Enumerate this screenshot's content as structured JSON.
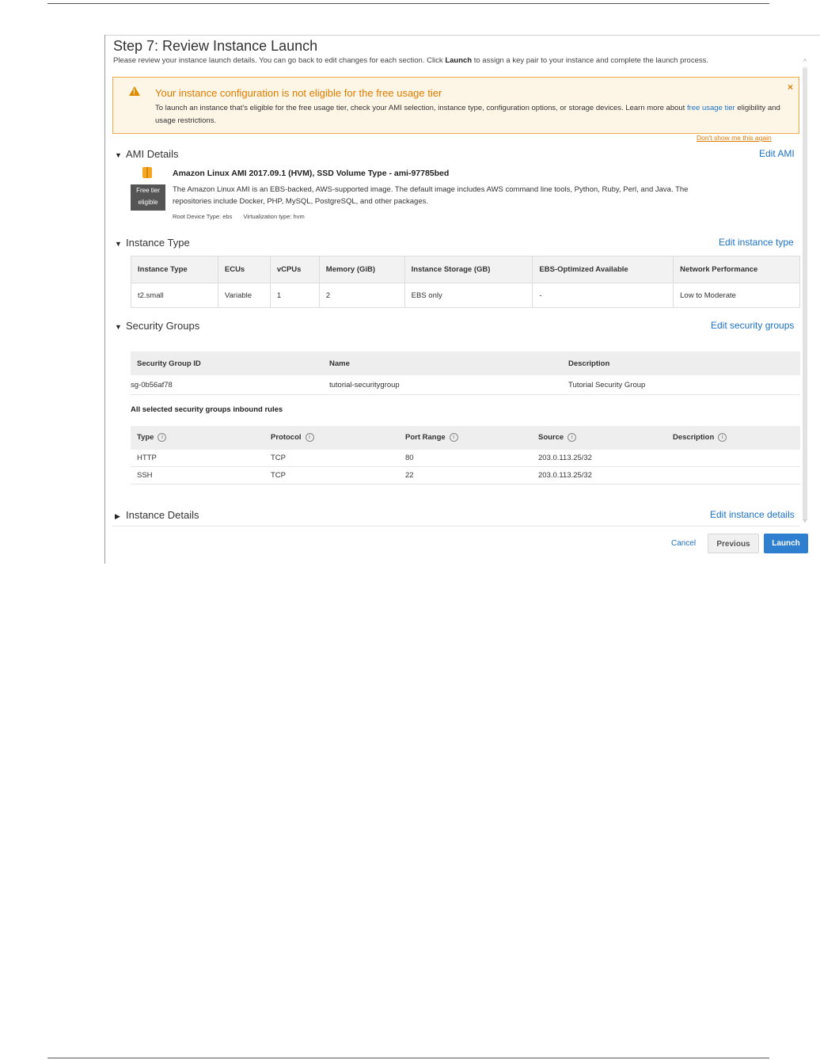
{
  "header": {
    "title": "Step 7: Review Instance Launch",
    "description_pre": "Please review your instance launch details. You can go back to edit changes for each section. Click ",
    "description_bold": "Launch",
    "description_post": " to assign a key pair to your instance and complete the launch process."
  },
  "warning": {
    "title": "Your instance configuration is not eligible for the free usage tier",
    "text_pre": "To launch an instance that's eligible for the free usage tier, check your AMI selection, instance type, configuration options, or storage devices. Learn more about ",
    "link_text": "free usage tier",
    "text_post": " eligibility and usage restrictions.",
    "close": "×",
    "dont_show": "Don't show me this again",
    "color": "#e07b00"
  },
  "ami": {
    "section_title": "AMI Details",
    "edit_link": "Edit AMI",
    "name": "Amazon Linux AMI 2017.09.1 (HVM), SSD Volume Type - ami-97785bed",
    "badge_line1": "Free tier",
    "badge_line2": "eligible",
    "description": "The Amazon Linux AMI is an EBS-backed, AWS-supported image. The default image includes AWS command line tools, Python, Ruby, Perl, and Java. The repositories include Docker, PHP, MySQL, PostgreSQL, and other packages.",
    "root_device": "Root Device Type: ebs",
    "virtualization": "Virtualization type: hvm"
  },
  "instance_type": {
    "section_title": "Instance Type",
    "edit_link": "Edit instance type",
    "columns": [
      "Instance Type",
      "ECUs",
      "vCPUs",
      "Memory (GiB)",
      "Instance Storage (GB)",
      "EBS-Optimized Available",
      "Network Performance"
    ],
    "row": [
      "t2.small",
      "Variable",
      "1",
      "2",
      "EBS only",
      "-",
      "Low to Moderate"
    ]
  },
  "security_groups": {
    "section_title": "Security Groups",
    "edit_link": "Edit security groups",
    "columns": [
      "Security Group ID",
      "Name",
      "Description"
    ],
    "row": [
      "sg-0b56af78",
      "tutorial-securitygroup",
      "Tutorial Security Group"
    ],
    "inbound_label": "All selected security groups inbound rules",
    "rule_columns": [
      "Type",
      "Protocol",
      "Port Range",
      "Source",
      "Description"
    ],
    "rules": [
      [
        "HTTP",
        "TCP",
        "80",
        "203.0.113.25/32",
        ""
      ],
      [
        "SSH",
        "TCP",
        "22",
        "203.0.113.25/32",
        ""
      ]
    ]
  },
  "instance_details": {
    "section_title": "Instance Details",
    "edit_link": "Edit instance details"
  },
  "footer": {
    "cancel": "Cancel",
    "previous": "Previous",
    "launch": "Launch",
    "launch_color": "#2f7fd1"
  },
  "icons": {
    "warning": "warning-triangle-icon",
    "expanded": "caret-down-icon",
    "collapsed": "caret-right-icon",
    "info": "info-icon",
    "ami": "cube-icon"
  }
}
